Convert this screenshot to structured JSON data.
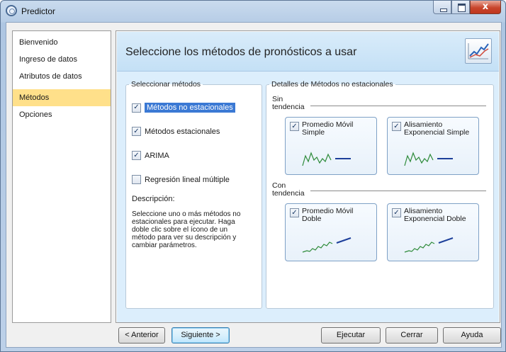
{
  "window": {
    "title": "Predictor",
    "close_glyph": "x"
  },
  "sidebar": {
    "items": [
      {
        "label": "Bienvenido",
        "active": false
      },
      {
        "label": "Ingreso de datos",
        "active": false
      },
      {
        "label": "Atributos de datos",
        "active": false
      },
      {
        "label": "Métodos",
        "active": true
      },
      {
        "label": "Opciones",
        "active": false
      }
    ],
    "active_color": "#ffe08a"
  },
  "header": {
    "title": "Seleccione los métodos de pronósticos a usar",
    "icon": "line-chart-icon"
  },
  "select_methods": {
    "legend": "Seleccionar métodos",
    "options": [
      {
        "label": "Métodos no estacionales",
        "checked": true,
        "highlighted": true
      },
      {
        "label": "Métodos estacionales",
        "checked": true,
        "highlighted": false
      },
      {
        "label": "ARIMA",
        "checked": true,
        "highlighted": false
      },
      {
        "label": "Regresión lineal múltiple",
        "checked": false,
        "highlighted": false
      }
    ],
    "description_label": "Descripción:",
    "description_text": "Seleccione uno o más métodos no estacionales para ejecutar. Haga doble clic sobre el ícono de un método para ver su descripción y cambiar parámetros."
  },
  "details": {
    "legend": "Detalles de Métodos no estacionales",
    "groups": [
      {
        "label_line1": "Sin",
        "label_line2": "tendencia",
        "methods": [
          {
            "label": "Promedio Móvil Simple",
            "checked": true
          },
          {
            "label": "Alisamiento Exponencial Simple",
            "checked": true
          }
        ]
      },
      {
        "label_line1": "Con",
        "label_line2": "tendencia",
        "methods": [
          {
            "label": "Promedio Móvil Doble",
            "checked": true
          },
          {
            "label": "Alisamiento Exponencial Doble",
            "checked": true
          }
        ]
      }
    ]
  },
  "footer": {
    "prev": "< Anterior",
    "next": "Siguiente >",
    "run": "Ejecutar",
    "close": "Cerrar",
    "help": "Ayuda"
  },
  "colors": {
    "accent": "#3b79d4",
    "header_band": "#c4e0f6",
    "spark_green": "#2e8b3a",
    "spark_blue": "#1d3f9a"
  }
}
